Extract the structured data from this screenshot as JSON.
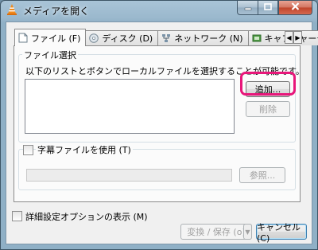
{
  "window": {
    "title": "メディアを開く"
  },
  "tabs": [
    {
      "label": "ファイル (F)",
      "icon": "file-icon"
    },
    {
      "label": "ディスク (D)",
      "icon": "disc-icon"
    },
    {
      "label": "ネットワーク (N)",
      "icon": "network-icon"
    },
    {
      "label": "キャプチャーデ",
      "icon": "capture-icon"
    }
  ],
  "file_selection": {
    "group_title": "ファイル選択",
    "description": "以下のリストとボタンでローカルファイルを選択することが可能です。",
    "add_label": "追加...",
    "remove_label": "削除"
  },
  "subtitle": {
    "checkbox_label": "字幕ファイルを使用 (T)",
    "browse_label": "参照..."
  },
  "advanced": {
    "checkbox_label": "詳細設定オプションの表示 (M)"
  },
  "footer": {
    "convert_label": "変換 / 保存 (o)",
    "cancel_label": "キャンセル (C)"
  },
  "colors": {
    "highlight": "#e8167a",
    "close_button": "#c0442a"
  }
}
